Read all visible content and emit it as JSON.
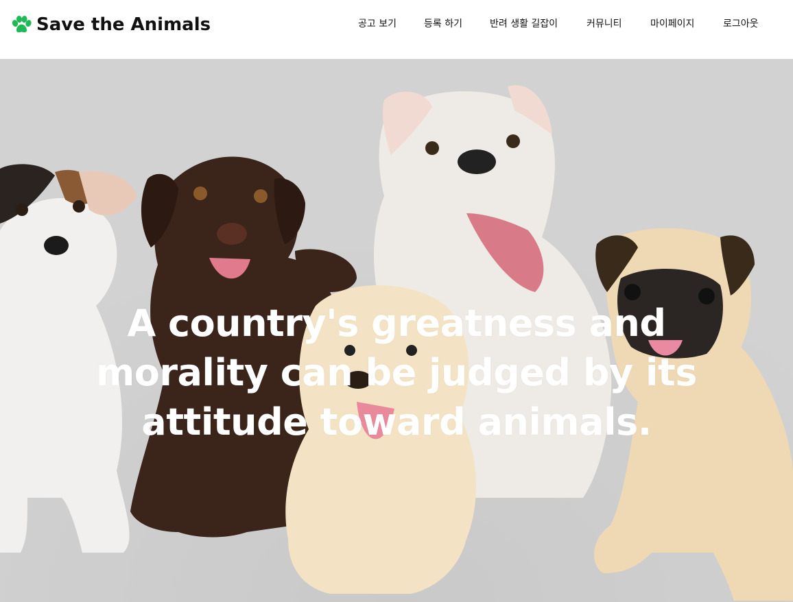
{
  "brand": {
    "name": "Save the Animals",
    "icon": "paw-icon",
    "icon_color": "#1fba56"
  },
  "nav": {
    "items": [
      {
        "label": "공고 보기"
      },
      {
        "label": "등록 하기"
      },
      {
        "label": "반려 생활 길잡이"
      },
      {
        "label": "커뮤니티"
      },
      {
        "label": "마이페이지"
      },
      {
        "label": "로그아웃"
      }
    ]
  },
  "hero": {
    "headline": "A country's greatness and morality can be judged by its attitude toward animals.",
    "background_color": "#cfcfcf"
  }
}
